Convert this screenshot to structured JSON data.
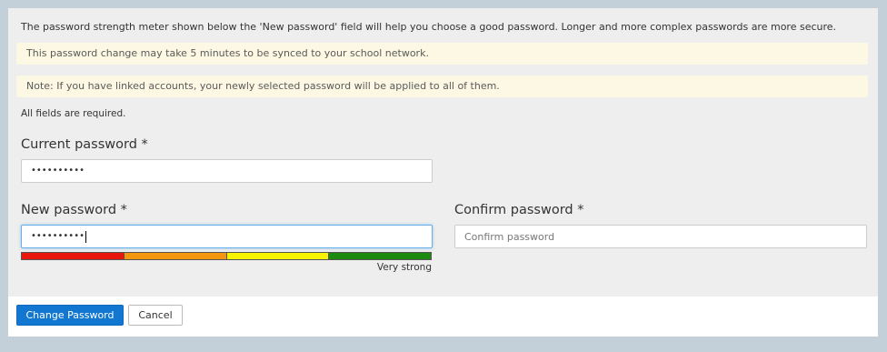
{
  "intro_text": "The password strength meter shown below the 'New password' field will help you choose a good password. Longer and more complex passwords are more secure.",
  "notices": [
    "This password change may take 5 minutes to be synced to your school network.",
    "Note: If you have linked accounts, your newly selected password will be applied to all of them."
  ],
  "required_note": "All fields are required.",
  "fields": {
    "current": {
      "label": "Current password *",
      "value_masked": "••••••••••"
    },
    "new": {
      "label": "New password *",
      "value_masked": "••••••••••"
    },
    "confirm": {
      "label": "Confirm password *",
      "placeholder": "Confirm password"
    }
  },
  "strength_meter": {
    "segment_colors": [
      "#e8160c",
      "#f5960f",
      "#f8f300",
      "#1b8a0f"
    ],
    "label": "Very strong"
  },
  "buttons": {
    "submit_label": "Change Password",
    "cancel_label": "Cancel"
  }
}
